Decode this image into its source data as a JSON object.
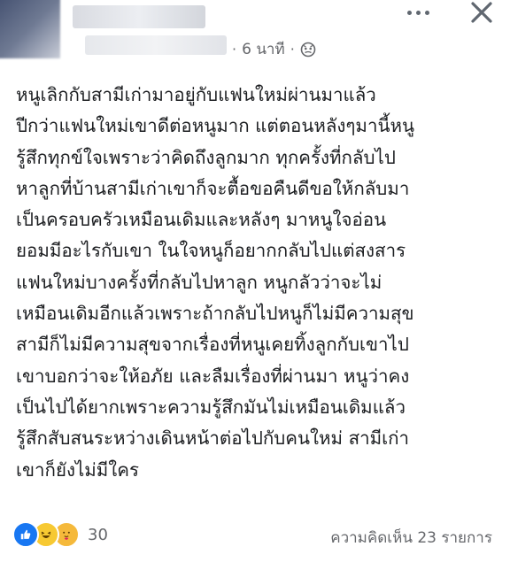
{
  "header": {
    "time": "6 นาที",
    "separator": "·"
  },
  "post": {
    "text": "หนูเลิกกับสามีเก่ามาอยู่กับแฟนใหม่ผ่านมาแล้ว\nปีกว่าแฟนใหม่เขาดีต่อหนูมาก แต่ตอนหลังๆมานี้หนู\nรู้สึกทุกข์ใจเพราะว่าคิดถึงลูกมาก ทุกครั้งที่กลับไป\nหาลูกที่บ้านสามีเก่าเขาก็จะตื้อขอคืนดีขอให้กลับมา\nเป็นครอบครัวเหมือนเดิมและหลังๆ มาหนูใจอ่อน\nยอมมีอะไรกับเขา ในใจหนูก็อยากกลับไปแต่สงสาร\nแฟนใหม่บางครั้งที่กลับไปหาลูก หนูกลัวว่าจะไม่\nเหมือนเดิมอีกแล้วเพราะถ้ากลับไปหนูก็ไม่มีความสุข\nสามีก็ไม่มีความสุขจากเรื่องที่หนูเคยทิ้งลูกกับเขาไป\nเขาบอกว่าจะให้อภัย และลืมเรื่องที่ผ่านมา หนูว่าคง\nเป็นไปได้ยากเพราะความรู้สึกมันไม่เหมือนเดิมแล้ว\nรู้สึกสับสนระหว่างเดินหน้าต่อไปกับคนใหม่ สามีเก่า\nเขาก็ยังไม่มีใคร"
  },
  "footer": {
    "reaction_count": "30",
    "comments": "ความคิดเห็น 23 รายการ",
    "reaction_icons": [
      "like-icon",
      "haha-icon",
      "care-icon"
    ]
  },
  "colors": {
    "like": "#1877f2",
    "meta_text": "#65676b",
    "body_text": "#1c1e21"
  }
}
